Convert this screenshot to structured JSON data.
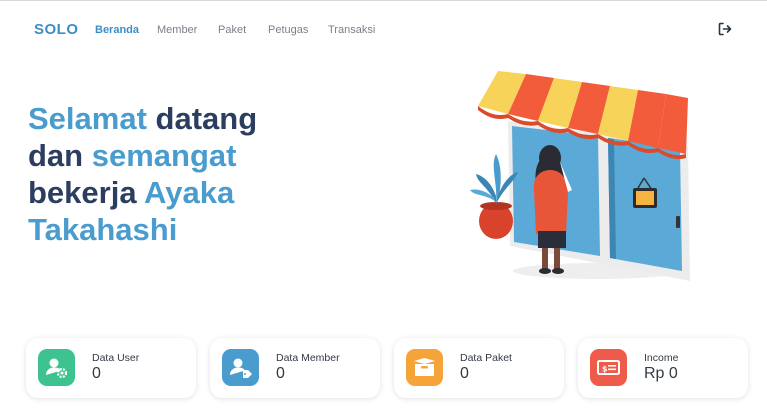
{
  "brand": "SOLO",
  "nav": {
    "items": [
      {
        "label": "Beranda",
        "active": true
      },
      {
        "label": "Member",
        "active": false
      },
      {
        "label": "Paket",
        "active": false
      },
      {
        "label": "Petugas",
        "active": false
      },
      {
        "label": "Transaksi",
        "active": false
      }
    ],
    "logout_icon": "logout-icon"
  },
  "hero": {
    "w1": "Selamat",
    "w2": "datang",
    "w3": "dan",
    "w4": "semangat",
    "w5": "bekerja",
    "w6": "Ayaka",
    "w7": "Takahashi"
  },
  "cards": [
    {
      "label": "Data User",
      "value": "0",
      "icon": "user-gear-icon",
      "color": "#3ec28f"
    },
    {
      "label": "Data Member",
      "value": "0",
      "icon": "user-tag-icon",
      "color": "#4a9ccf"
    },
    {
      "label": "Data Paket",
      "value": "0",
      "icon": "box-icon",
      "color": "#f5a43a"
    },
    {
      "label": "Income",
      "value": "Rp 0",
      "icon": "money-icon",
      "color": "#ef5a4a"
    }
  ],
  "colors": {
    "accent": "#3a8fc7",
    "dark_text": "#2c3e5f",
    "highlight": "#4a9ccf"
  }
}
